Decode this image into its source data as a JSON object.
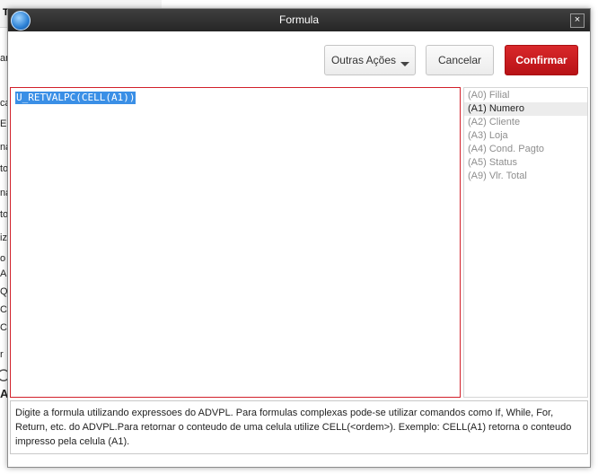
{
  "window": {
    "title": "Formula",
    "close_glyph": "×"
  },
  "background": {
    "topbar_label": "T",
    "items": [
      "an",
      "ca",
      "E S",
      "na",
      "to",
      "na",
      "to",
      "iz",
      "o",
      "A",
      "Q",
      "C",
      "C",
      "r",
      "A"
    ]
  },
  "toolbar": {
    "outras_label": "Outras Ações",
    "cancel_label": "Cancelar",
    "confirm_label": "Confirmar"
  },
  "editor": {
    "text": "U_RETVALPC(CELL(A1))"
  },
  "fields": {
    "items": [
      {
        "label": "(A0) Filial"
      },
      {
        "label": "(A1) Numero"
      },
      {
        "label": "(A2) Cliente"
      },
      {
        "label": "(A3) Loja"
      },
      {
        "label": "(A4) Cond. Pagto"
      },
      {
        "label": "(A5) Status"
      },
      {
        "label": "(A9) Vlr. Total"
      }
    ],
    "selected_index": 1
  },
  "help": {
    "text": "Digite a formula utilizando expressoes do ADVPL. Para formulas complexas pode-se utilizar comandos como If, While, For, Return, etc. do ADVPL.Para retornar o conteudo de uma celula utilize CELL(<ordem>). Exemplo: CELL(A1) retorna o conteudo impresso pela celula (A1)."
  },
  "colors": {
    "confirm_button": "#c8191d",
    "editor_border": "#d2202a",
    "selection": "#3a8fe6",
    "titlebar": "#2e2e2e"
  }
}
